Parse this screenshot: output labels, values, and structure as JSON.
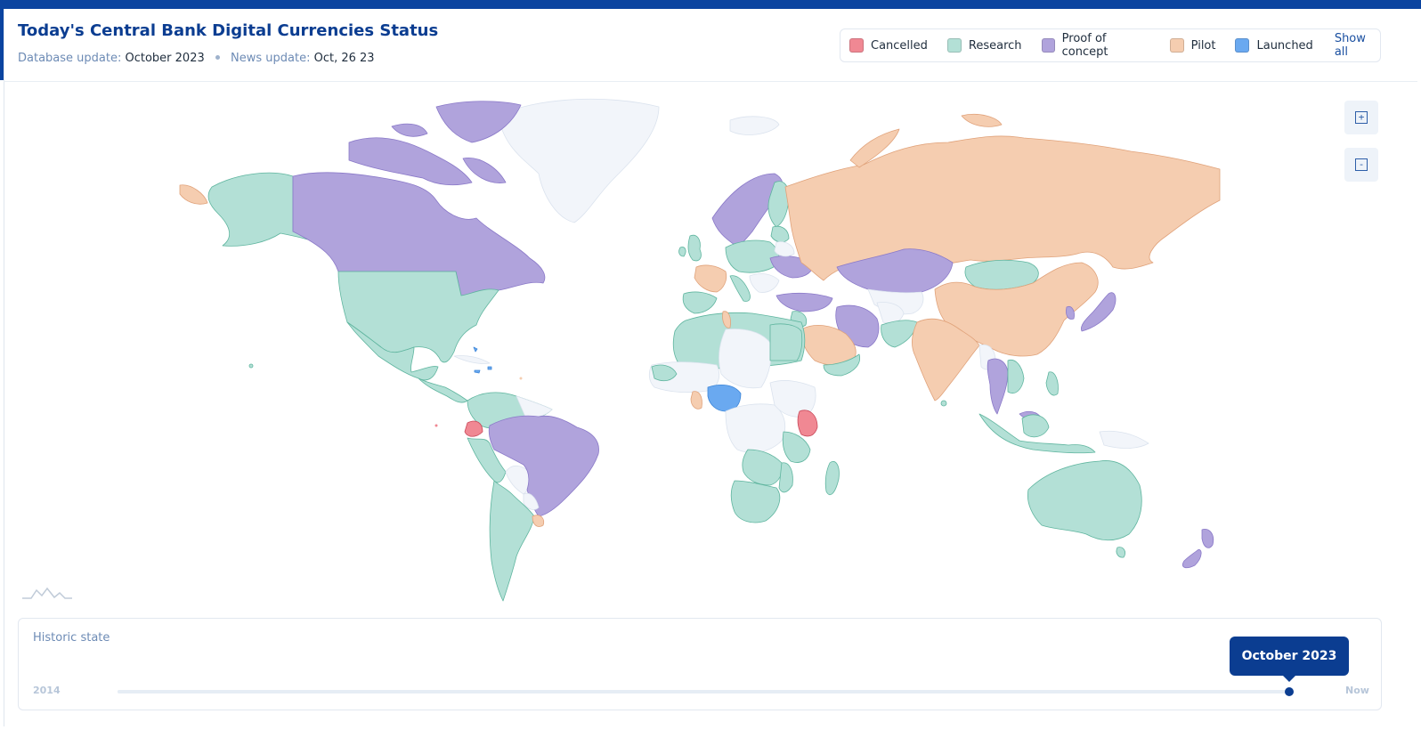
{
  "header": {
    "title": "Today's Central Bank Digital Currencies Status",
    "db_label": "Database update:",
    "db_value": "October 2023",
    "news_label": "News update:",
    "news_value": "Oct, 26 23"
  },
  "legend": {
    "items": [
      {
        "label": "Cancelled",
        "color": "#f08893"
      },
      {
        "label": "Research",
        "color": "#b3e0d6"
      },
      {
        "label": "Proof of concept",
        "color": "#b0a3dc"
      },
      {
        "label": "Pilot",
        "color": "#f5cdb0"
      },
      {
        "label": "Launched",
        "color": "#6aa9f0"
      }
    ],
    "show_all": "Show all"
  },
  "map": {
    "zoom_in": "+",
    "zoom_out": "-",
    "colors": {
      "none": "#f2f5fa",
      "cancelled": "#f08893",
      "research": "#b3e0d6",
      "poc": "#b0a3dc",
      "pilot": "#f5cdb0",
      "launched": "#6aa9f0",
      "border_research": "#5fb59f",
      "border_poc": "#8a79c8",
      "border_pilot": "#e0a27a"
    }
  },
  "history": {
    "title": "Historic state",
    "start": "2014",
    "end": "Now",
    "current": "October 2023",
    "progress": 1.0
  }
}
